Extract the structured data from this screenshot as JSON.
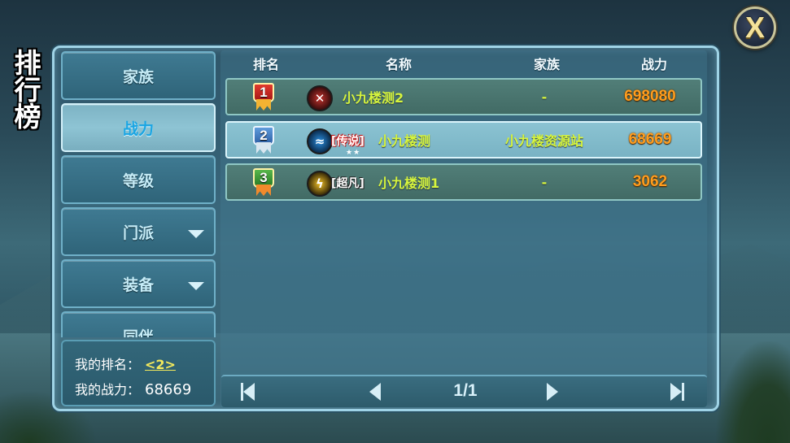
{
  "page_title": "排行榜",
  "close_label": "X",
  "sidebar": {
    "tabs": [
      {
        "label": "家族",
        "active": false,
        "has_dropdown": false
      },
      {
        "label": "战力",
        "active": true,
        "has_dropdown": false
      },
      {
        "label": "等级",
        "active": false,
        "has_dropdown": false
      },
      {
        "label": "门派",
        "active": false,
        "has_dropdown": true
      },
      {
        "label": "装备",
        "active": false,
        "has_dropdown": true
      },
      {
        "label": "同伴",
        "active": false,
        "has_dropdown": false
      }
    ]
  },
  "my_info": {
    "rank_label": "我的排名：",
    "rank_value": "<2>",
    "power_label": "我的战力：",
    "power_value": "68669"
  },
  "table": {
    "headers": {
      "rank": "排名",
      "name": "名称",
      "guild": "家族",
      "power": "战力"
    },
    "rows": [
      {
        "rank": "1",
        "avatar_icon": "crossed-swords-icon",
        "title": "",
        "stars": "",
        "name": "小九楼测2",
        "guild": "-",
        "power": "698080"
      },
      {
        "rank": "2",
        "avatar_icon": "blue-wave-icon",
        "title": "[传说]",
        "stars": "★★",
        "name": "小九楼测",
        "guild": "小九楼资源站",
        "power": "68669"
      },
      {
        "rank": "3",
        "avatar_icon": "golden-feather-icon",
        "title": "[超凡]",
        "stars": "",
        "name": "小九楼测1",
        "guild": "-",
        "power": "3062"
      }
    ],
    "selected_row": 2
  },
  "pager": {
    "page_text": "1/1",
    "first_icon": "first-page-icon",
    "prev_icon": "prev-page-icon",
    "next_icon": "next-page-icon",
    "last_icon": "last-page-icon"
  },
  "colors": {
    "name_text": "#d7f53d",
    "power_text": "#ff9d1e",
    "active_tab_text": "#1aa5e3",
    "rank_highlight": "#f3e95c"
  }
}
